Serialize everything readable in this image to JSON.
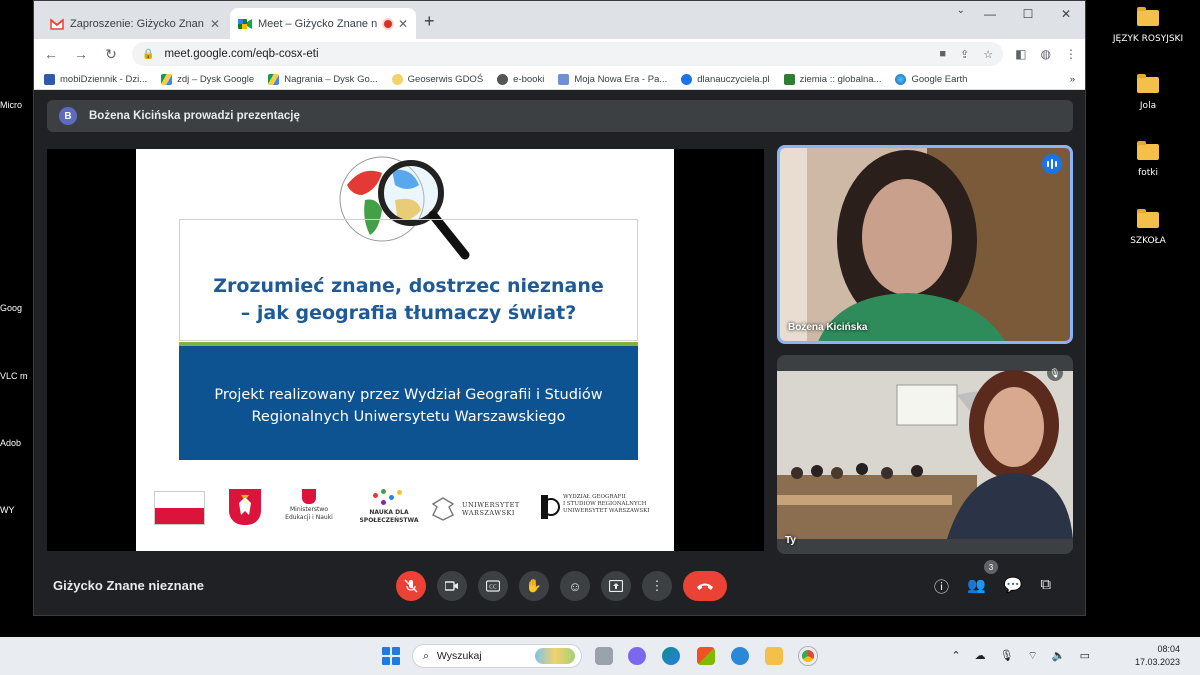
{
  "browser": {
    "tabs": [
      {
        "title": "Zaproszenie: Giżycko Znane niez",
        "active": false
      },
      {
        "title": "Meet – Giżycko Znane niezn",
        "active": true
      }
    ],
    "url": "meet.google.com/eqb-cosx-eti",
    "bookmarks": [
      "mobiDziennik - Dzi...",
      "zdj – Dysk Google",
      "Nagrania – Dysk Go...",
      "Geoserwis GDOŚ",
      "e-booki",
      "Moja Nowa Era - Pa...",
      "dlanauczyciela.pl",
      "ziemia :: globalna...",
      "Google Earth"
    ]
  },
  "meet": {
    "presenter_initial": "B",
    "presenter_text": "Bożena Kicińska prowadzi prezentację",
    "meeting_name": "Giżycko Znane nieznane",
    "participant_count": "3",
    "tiles": [
      {
        "name": "Bożena Kicińska",
        "speaking": true
      },
      {
        "name": "Ty",
        "muted": true
      }
    ]
  },
  "slide": {
    "title_line1": "Zrozumieć znane, dostrzec nieznane",
    "title_line2": "– jak geografia tłumaczy świat?",
    "band_line1": "Projekt realizowany przez Wydział Geografii i Studiów",
    "band_line2": "Regionalnych Uniwersytetu Warszawskiego",
    "logo_ministry_1": "Ministerstwo",
    "logo_ministry_2": "Edukacji i Nauki",
    "logo_nauka_1": "NAUKA DLA",
    "logo_nauka_2": "SPOŁECZEŃSTWA",
    "logo_uw_1": "UNIWERSYTET",
    "logo_uw_2": "WARSZAWSKI",
    "logo_wgsr_1": "WYDZIAŁ GEOGRAFII",
    "logo_wgsr_2": "I STUDIÓW REGIONALNYCH",
    "logo_wgsr_3": "UNIWERSYTET WARSZAWSKI"
  },
  "desktop": {
    "right_icons": [
      "JĘZYK ROSYJSKI",
      "Jola",
      "fotki",
      "SZKOŁA"
    ],
    "left_labels": [
      "Micro",
      "Goog",
      "VLC m",
      "Adob",
      "WY"
    ]
  },
  "taskbar": {
    "search_placeholder": "Wyszukaj",
    "time": "08:04",
    "date": "17.03.2023"
  }
}
